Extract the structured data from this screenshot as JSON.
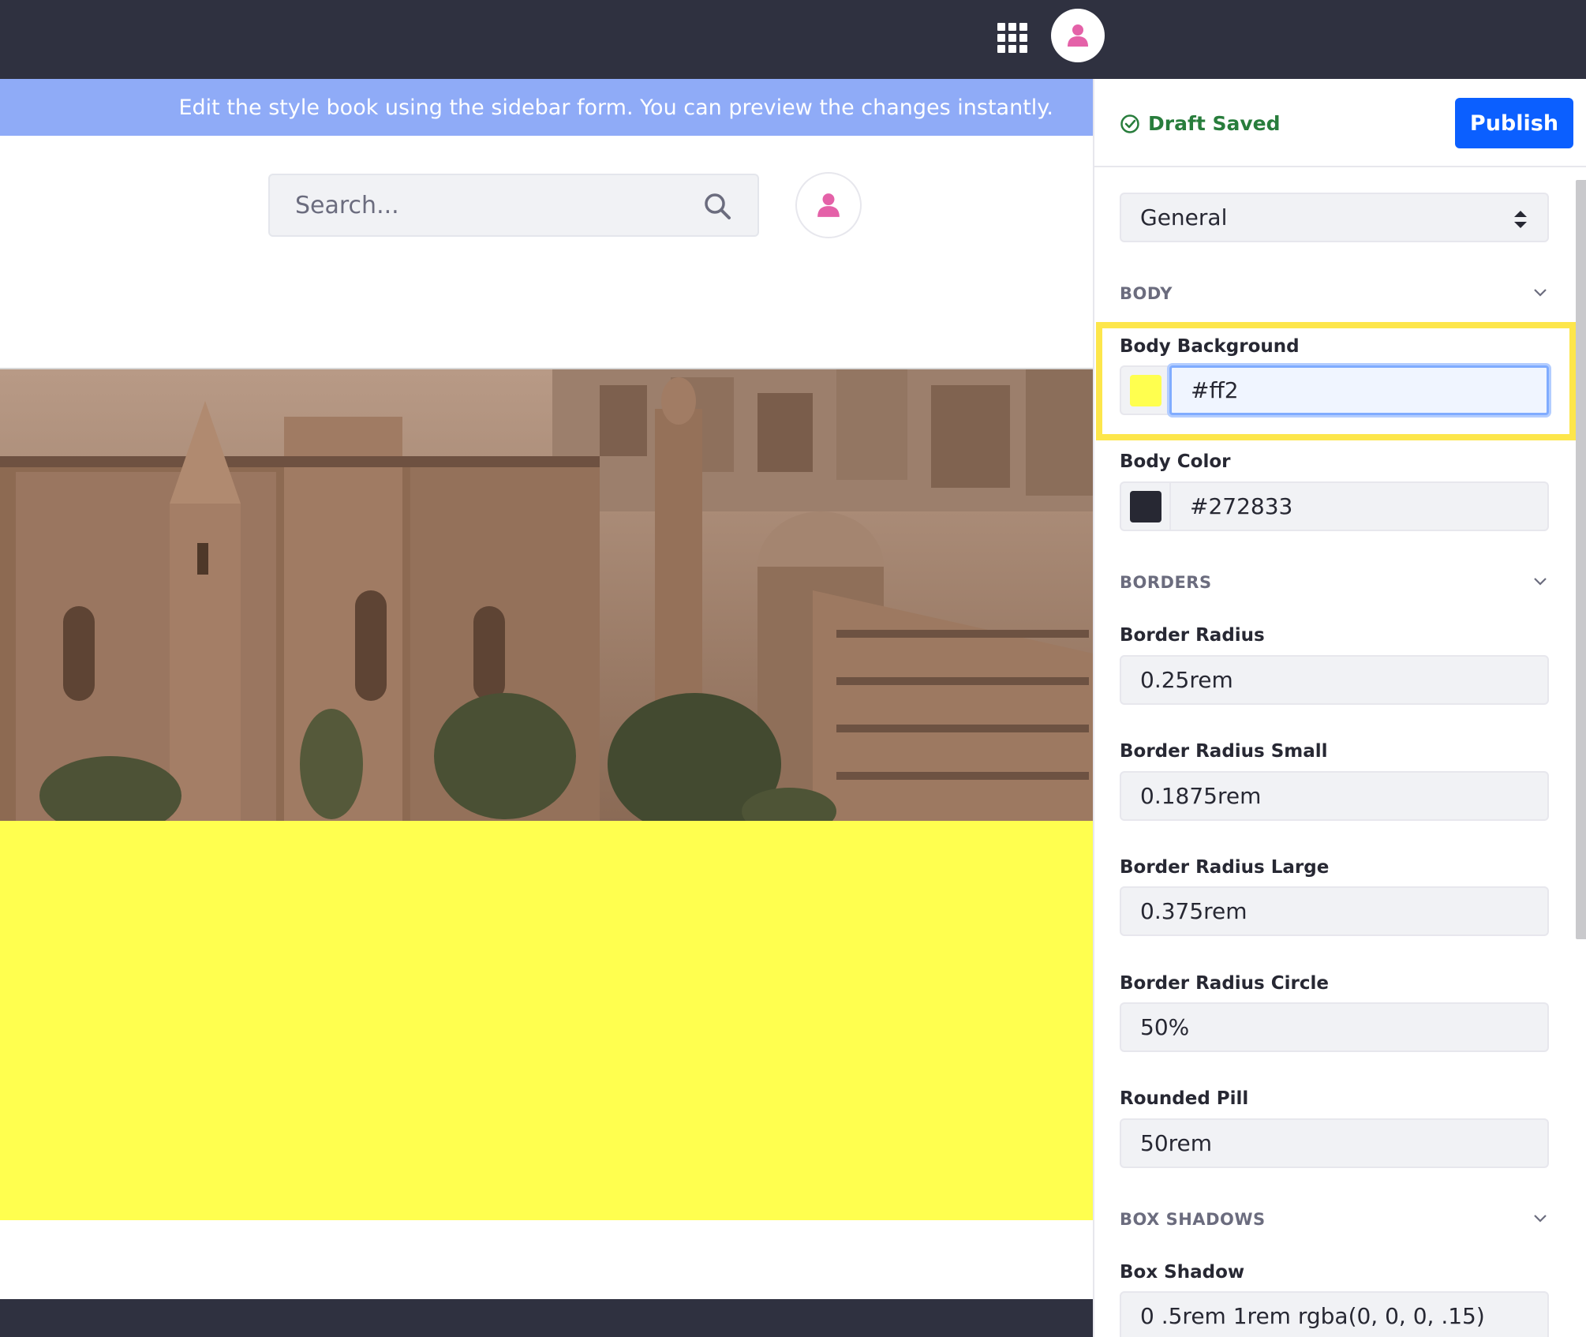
{
  "colors": {
    "topbar": "#2f3140",
    "banner": "#8fabf7",
    "body_background_preview": "#ffff4f",
    "accent": "#0b5fff",
    "avatar_pink": "#e461a8",
    "draft_green": "#287d3c",
    "highlight": "#fde64b"
  },
  "topbar": {
    "apps_icon": "apps-grid-icon",
    "avatar_icon": "user-icon"
  },
  "preview": {
    "banner_text": "Edit the style book using the sidebar form. You can preview the changes instantly.",
    "search_placeholder": "Search...",
    "search_icon": "search-icon",
    "avatar_icon": "user-icon",
    "hero_image": "cityscape-photo"
  },
  "sidebar": {
    "draft_status": "Draft Saved",
    "publish_label": "Publish",
    "selected_group": "General",
    "sections": {
      "body": "BODY",
      "borders": "BORDERS",
      "box_shadows": "BOX SHADOWS"
    },
    "fields": {
      "body_background": {
        "label": "Body Background",
        "value": "#ff2",
        "swatch": "#ffff4f"
      },
      "body_color": {
        "label": "Body Color",
        "value": "#272833",
        "swatch": "#272833"
      },
      "border_radius": {
        "label": "Border Radius",
        "value": "0.25rem"
      },
      "border_radius_small": {
        "label": "Border Radius Small",
        "value": "0.1875rem"
      },
      "border_radius_large": {
        "label": "Border Radius Large",
        "value": "0.375rem"
      },
      "border_radius_circle": {
        "label": "Border Radius Circle",
        "value": "50%"
      },
      "rounded_pill": {
        "label": "Rounded Pill",
        "value": "50rem"
      },
      "box_shadow": {
        "label": "Box Shadow",
        "value": "0 .5rem 1rem rgba(0, 0, 0, .15)"
      }
    }
  }
}
